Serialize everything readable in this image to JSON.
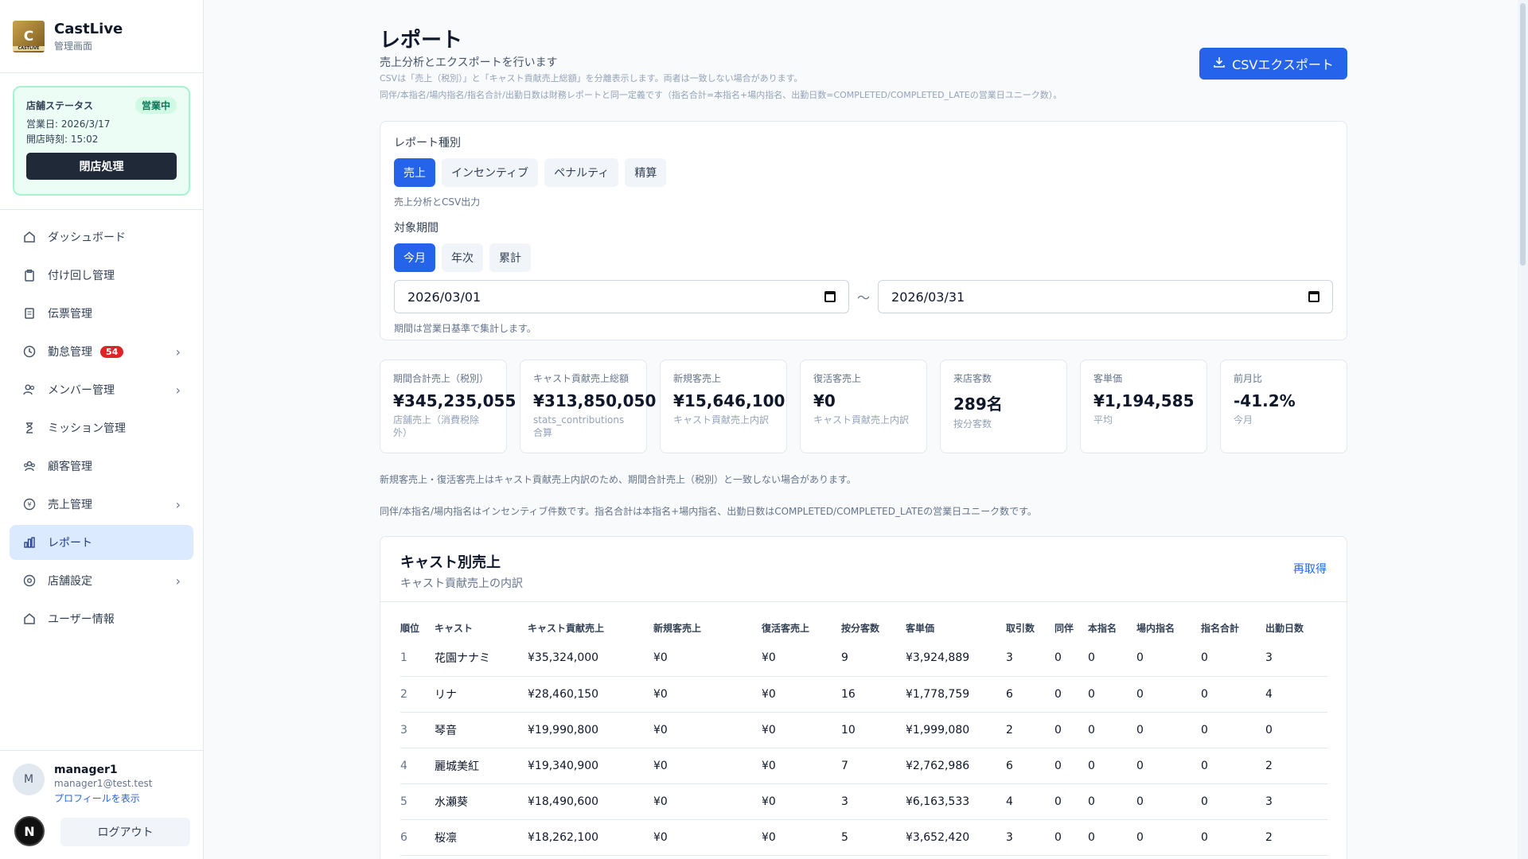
{
  "brand": {
    "name": "CastLive",
    "sub": "管理画面",
    "logo_text": "CASTLIVE"
  },
  "shop": {
    "label": "店舗ステータス",
    "status": "営業中",
    "business_day": "営業日: 2026/3/17",
    "open_time": "開店時刻: 15:02",
    "close_button": "閉店処理"
  },
  "nav": {
    "items": [
      {
        "label": "ダッシュボード"
      },
      {
        "label": "付け回し管理"
      },
      {
        "label": "伝票管理"
      },
      {
        "label": "勤怠管理",
        "count": "54"
      },
      {
        "label": "メンバー管理"
      },
      {
        "label": "ミッション管理"
      },
      {
        "label": "顧客管理"
      },
      {
        "label": "売上管理"
      },
      {
        "label": "レポート"
      },
      {
        "label": "店舗設定"
      },
      {
        "label": "ユーザー情報"
      }
    ]
  },
  "user": {
    "avatar": "M",
    "name": "manager1",
    "email": "manager1@test.test",
    "profile_link": "プロフィールを表示",
    "logout": "ログアウト",
    "n_badge": "N"
  },
  "header": {
    "title": "レポート",
    "subtitle": "売上分析とエクスポートを行います",
    "note1": "CSVは「売上（税別）」と「キャスト貢献売上総額」を分離表示します。両者は一致しない場合があります。",
    "note2": "同伴/本指名/場内指名/指名合計/出勤日数は財務レポートと同一定義です（指名合計=本指名+場内指名、出勤日数=COMPLETED/COMPLETED_LATEの営業日ユニーク数）。",
    "csv_button": "CSVエクスポート"
  },
  "filters": {
    "type_label": "レポート種別",
    "types": [
      "売上",
      "インセンティブ",
      "ペナルティ",
      "精算"
    ],
    "type_hint": "売上分析とCSV出力",
    "period_label": "対象期間",
    "periods": [
      "今月",
      "年次",
      "累計"
    ],
    "date_from": "2026/03/01",
    "date_sep": "〜",
    "date_to": "2026/03/31",
    "period_hint": "期間は営業日基準で集計します。"
  },
  "cards": [
    {
      "label": "期間合計売上（税別）",
      "value": "¥345,235,055",
      "sub": "店舗売上（消費税除外）"
    },
    {
      "label": "キャスト貢献売上総額",
      "value": "¥313,850,050",
      "sub": "stats_contributions 合算"
    },
    {
      "label": "新規客売上",
      "value": "¥15,646,100",
      "sub": "キャスト貢献売上内訳"
    },
    {
      "label": "復活客売上",
      "value": "¥0",
      "sub": "キャスト貢献売上内訳"
    },
    {
      "label": "来店客数",
      "value": "289名",
      "sub": "按分客数"
    },
    {
      "label": "客単価",
      "value": "¥1,194,585",
      "sub": "平均"
    },
    {
      "label": "前月比",
      "value": "-41.2%",
      "sub": "今月"
    }
  ],
  "info": {
    "line1": "新規客売上・復活客売上はキャスト貢献売上内訳のため、期間合計売上（税別）と一致しない場合があります。",
    "line2": "同伴/本指名/場内指名はインセンティブ件数です。指名合計は本指名+場内指名、出勤日数はCOMPLETED/COMPLETED_LATEの営業日ユニーク数です。"
  },
  "table": {
    "title": "キャスト別売上",
    "subtitle": "キャスト貢献売上の内訳",
    "refresh": "再取得",
    "columns": [
      "順位",
      "キャスト",
      "キャスト貢献売上",
      "新規客売上",
      "復活客売上",
      "按分客数",
      "客単価",
      "取引数",
      "同伴",
      "本指名",
      "場内指名",
      "指名合計",
      "出勤日数"
    ],
    "rows": [
      [
        "1",
        "花園ナナミ",
        "¥35,324,000",
        "¥0",
        "¥0",
        "9",
        "¥3,924,889",
        "3",
        "0",
        "0",
        "0",
        "0",
        "3"
      ],
      [
        "2",
        "リナ",
        "¥28,460,150",
        "¥0",
        "¥0",
        "16",
        "¥1,778,759",
        "6",
        "0",
        "0",
        "0",
        "0",
        "4"
      ],
      [
        "3",
        "琴音",
        "¥19,990,800",
        "¥0",
        "¥0",
        "10",
        "¥1,999,080",
        "2",
        "0",
        "0",
        "0",
        "0",
        "0"
      ],
      [
        "4",
        "麗城美紅",
        "¥19,340,900",
        "¥0",
        "¥0",
        "7",
        "¥2,762,986",
        "6",
        "0",
        "0",
        "0",
        "0",
        "2"
      ],
      [
        "5",
        "水瀬葵",
        "¥18,490,600",
        "¥0",
        "¥0",
        "3",
        "¥6,163,533",
        "4",
        "0",
        "0",
        "0",
        "0",
        "3"
      ],
      [
        "6",
        "桜凛",
        "¥18,262,100",
        "¥0",
        "¥0",
        "5",
        "¥3,652,420",
        "3",
        "0",
        "0",
        "0",
        "0",
        "2"
      ]
    ]
  }
}
